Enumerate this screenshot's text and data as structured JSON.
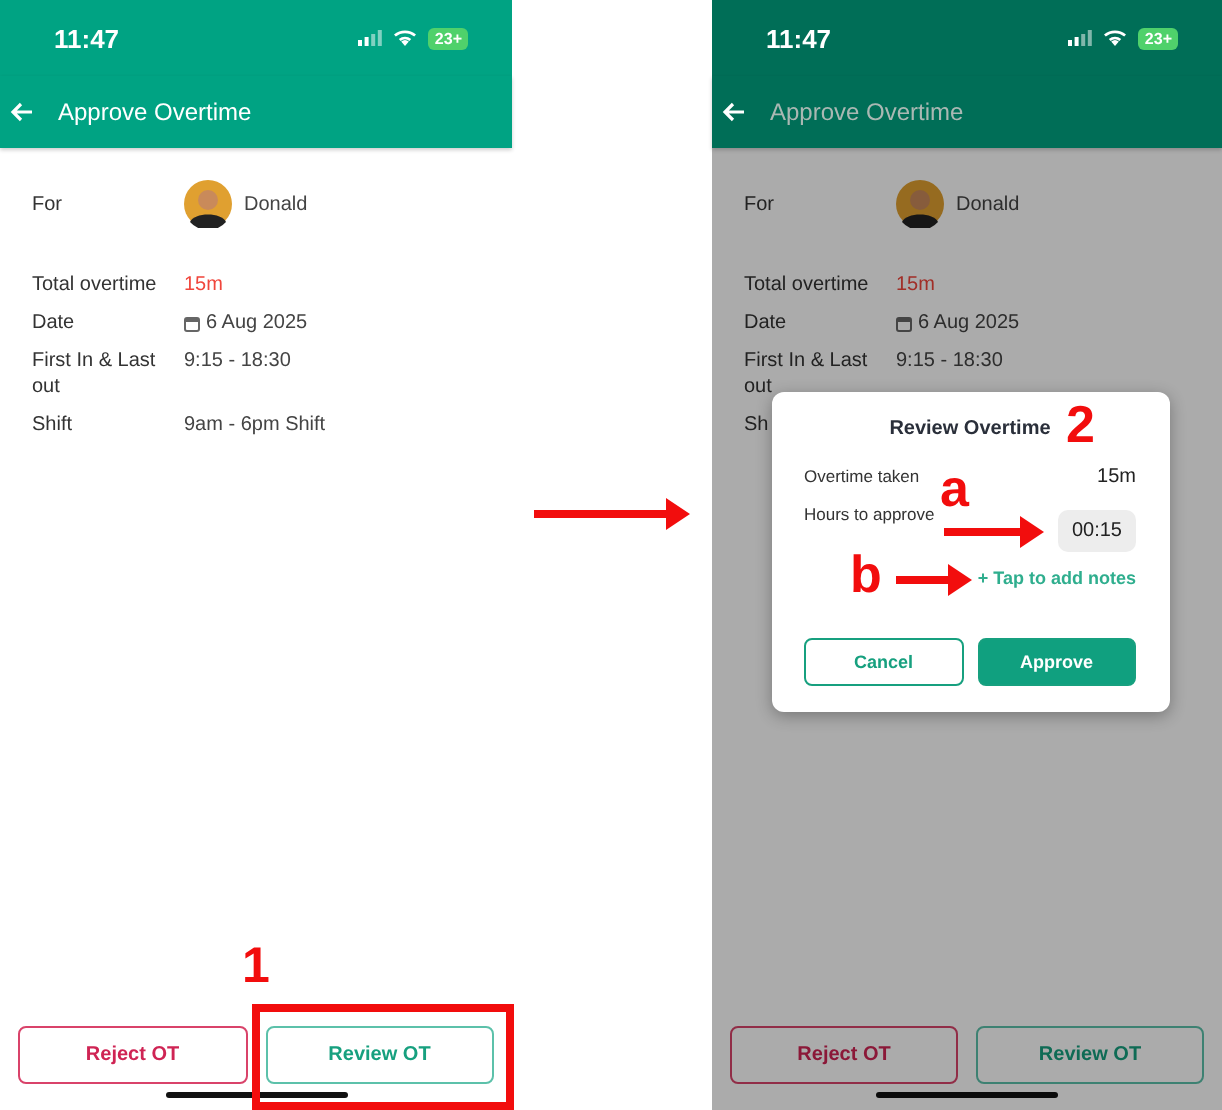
{
  "screens": [
    {
      "dimmed": false,
      "status_bar": {
        "time": "11:47",
        "battery": "23+"
      },
      "header": {
        "title": "Approve Overtime"
      },
      "details": {
        "for_label": "For",
        "person": "Donald",
        "rows": [
          {
            "label": "Total overtime",
            "value": "15m",
            "kind": "alert"
          },
          {
            "label": "Date",
            "value": "6 Aug 2025",
            "kind": "date"
          },
          {
            "label": "First In & Last out",
            "value": "9:15 - 18:30",
            "kind": "plain"
          },
          {
            "label": "Shift",
            "value": "9am - 6pm Shift",
            "kind": "plain"
          }
        ]
      },
      "actions": [
        {
          "label": "Reject OT",
          "kind": "reject"
        },
        {
          "label": "Review OT",
          "kind": "review"
        }
      ]
    },
    {
      "dimmed": true,
      "status_bar": {
        "time": "11:47",
        "battery": "23+"
      },
      "header": {
        "title": "Approve Overtime"
      },
      "details": {
        "for_label": "For",
        "person": "Donald",
        "rows": [
          {
            "label": "Total overtime",
            "value": "15m",
            "kind": "alert"
          },
          {
            "label": "Date",
            "value": "6 Aug 2025",
            "kind": "date"
          },
          {
            "label": "First In & Last out",
            "value": "9:15 - 18:30",
            "kind": "plain"
          },
          {
            "label": "Sh"
          }
        ]
      },
      "actions": [
        {
          "label": "Reject OT",
          "kind": "reject"
        },
        {
          "label": "Review OT",
          "kind": "review"
        }
      ],
      "dialog": {
        "title": "Review Overtime",
        "rows": [
          {
            "label": "Overtime taken",
            "value": "15m",
            "kind": "text"
          },
          {
            "label": "Hours to approve",
            "value": "00:15",
            "kind": "time"
          }
        ],
        "notes_link": "+ Tap to add notes",
        "buttons": [
          {
            "label": "Cancel",
            "kind": "secondary"
          },
          {
            "label": "Approve",
            "kind": "primary"
          }
        ]
      }
    }
  ],
  "annotations": {
    "step_1": "1",
    "step_2": "2",
    "marker_a": "a",
    "marker_b": "b"
  }
}
